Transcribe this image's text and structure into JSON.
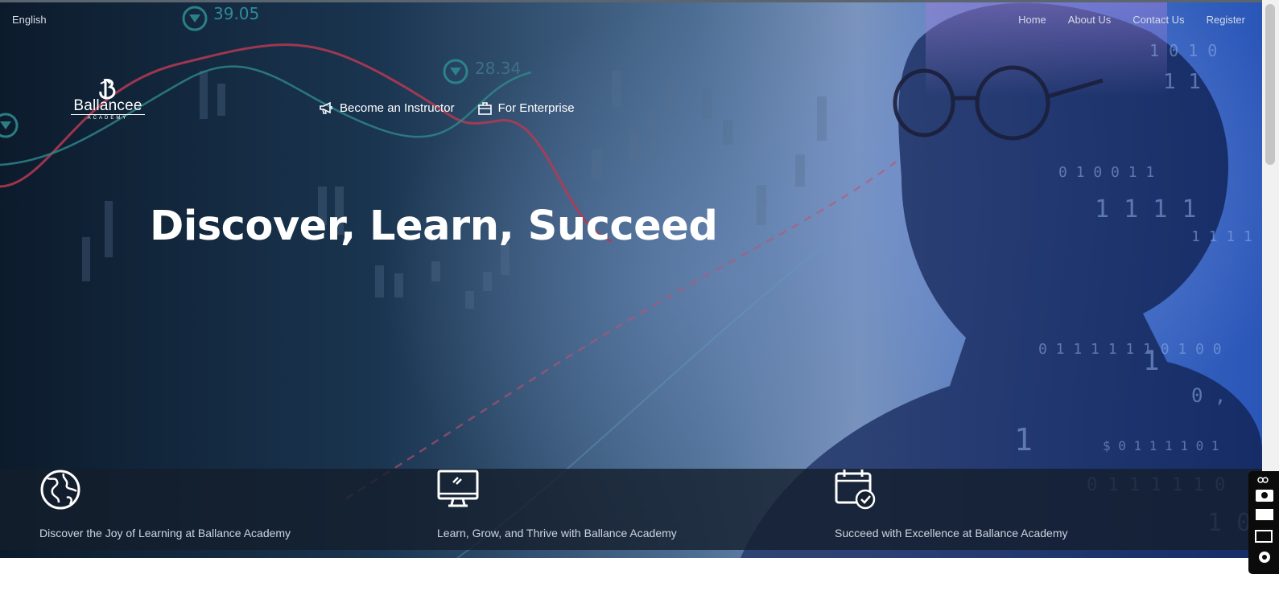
{
  "header": {
    "language": "English",
    "nav": [
      {
        "label": "Home"
      },
      {
        "label": "About Us"
      },
      {
        "label": "Contact Us"
      },
      {
        "label": "Register"
      }
    ]
  },
  "logo": {
    "name": "Ballancee",
    "sub": "ACADEMY"
  },
  "secondary_nav": [
    {
      "label": "Become an Instructor",
      "icon": "megaphone-icon"
    },
    {
      "label": "For Enterprise",
      "icon": "briefcase-icon"
    }
  ],
  "hero": {
    "headline": "Discover, Learn, Succeed",
    "background_numbers": [
      "39.05",
      "28.34"
    ]
  },
  "features": [
    {
      "icon": "globe-icon",
      "text": "Discover the Joy of Learning at Ballance Academy"
    },
    {
      "icon": "monitor-icon",
      "text": "Learn, Grow, and Thrive with Ballance Academy"
    },
    {
      "icon": "calendar-check-icon",
      "text": "Succeed with Excellence at Ballance Academy"
    }
  ],
  "colors": {
    "hero_dark": "#0c1b2c",
    "hero_blue": "#2a56b8",
    "feature_strip": "#141e2c",
    "text_white": "#ffffff",
    "nav_text": "#d3dae6"
  }
}
